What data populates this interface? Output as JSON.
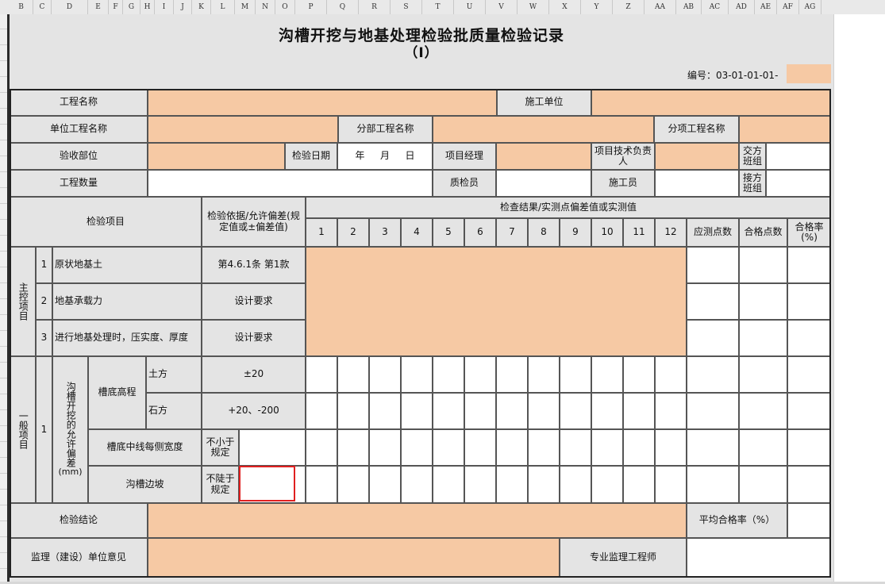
{
  "spreadsheet": {
    "columns": [
      "B",
      "C",
      "D",
      "E",
      "F",
      "G",
      "H",
      "I",
      "J",
      "K",
      "L",
      "M",
      "N",
      "O",
      "P",
      "Q",
      "R",
      "S",
      "T",
      "U",
      "V",
      "W",
      "X",
      "Y",
      "Z",
      "AA",
      "AB",
      "AC",
      "AD",
      "AE",
      "AF",
      "AG"
    ]
  },
  "form": {
    "title": "沟槽开挖与地基处理检验批质量检验记录",
    "subtitle": "（Ⅰ）",
    "code_label": "编号：03-01-01-01-",
    "code_value": "",
    "header": {
      "project_name": "工程名称",
      "construction_unit": "施工单位",
      "unit_project_name": "单位工程名称",
      "division_project_name": "分部工程名称",
      "subitem_project_name": "分项工程名称",
      "acceptance_part": "验收部位",
      "inspection_date_label": "检验日期",
      "date_year": "年",
      "date_month": "月",
      "date_day": "日",
      "project_manager": "项目经理",
      "technical_lead": "项目技术负责人",
      "handover_team": "交方班组",
      "work_quantity": "工程数量",
      "quality_inspector": "质检员",
      "constructor": "施工员",
      "receiving_team": "接方班组"
    },
    "table": {
      "inspection_item": "检验项目",
      "basis": "检验依据/允许偏差(规定值或±偏差值)",
      "results_header": "检查结果/实测点偏差值或实测值",
      "point_numbers": [
        "1",
        "2",
        "3",
        "4",
        "5",
        "6",
        "7",
        "8",
        "9",
        "10",
        "11",
        "12"
      ],
      "points_to_measure": "应测点数",
      "qualified_points": "合格点数",
      "pass_rate": "合格率(%)"
    },
    "main_control": {
      "group_label": "主控项目",
      "rows": [
        {
          "num": "1",
          "item": "原状地基土",
          "basis": "第4.6.1条 第1款"
        },
        {
          "num": "2",
          "item": "地基承载力",
          "basis": "设计要求"
        },
        {
          "num": "3",
          "item": "进行地基处理时，压实度、厚度",
          "basis": "设计要求"
        }
      ]
    },
    "general": {
      "group_label": "一般项目",
      "num": "1",
      "sub_label": "沟槽开挖的允许偏差",
      "sub_unit": "(mm)",
      "trench_bottom_elevation": "槽底高程",
      "earth": "土方",
      "earth_tol": "±20",
      "rock": "石方",
      "rock_tol": "+20、-200",
      "centerline_width": "槽底中线每侧宽度",
      "centerline_tol": "不小于规定",
      "slope": "沟槽边坡",
      "slope_tol": "不陡于规定"
    },
    "footer": {
      "conclusion": "检验结论",
      "avg_pass_rate": "平均合格率（%）",
      "supervisor_opinion": "监理（建设）单位意见",
      "supervisor_engineer": "专业监理工程师"
    }
  }
}
